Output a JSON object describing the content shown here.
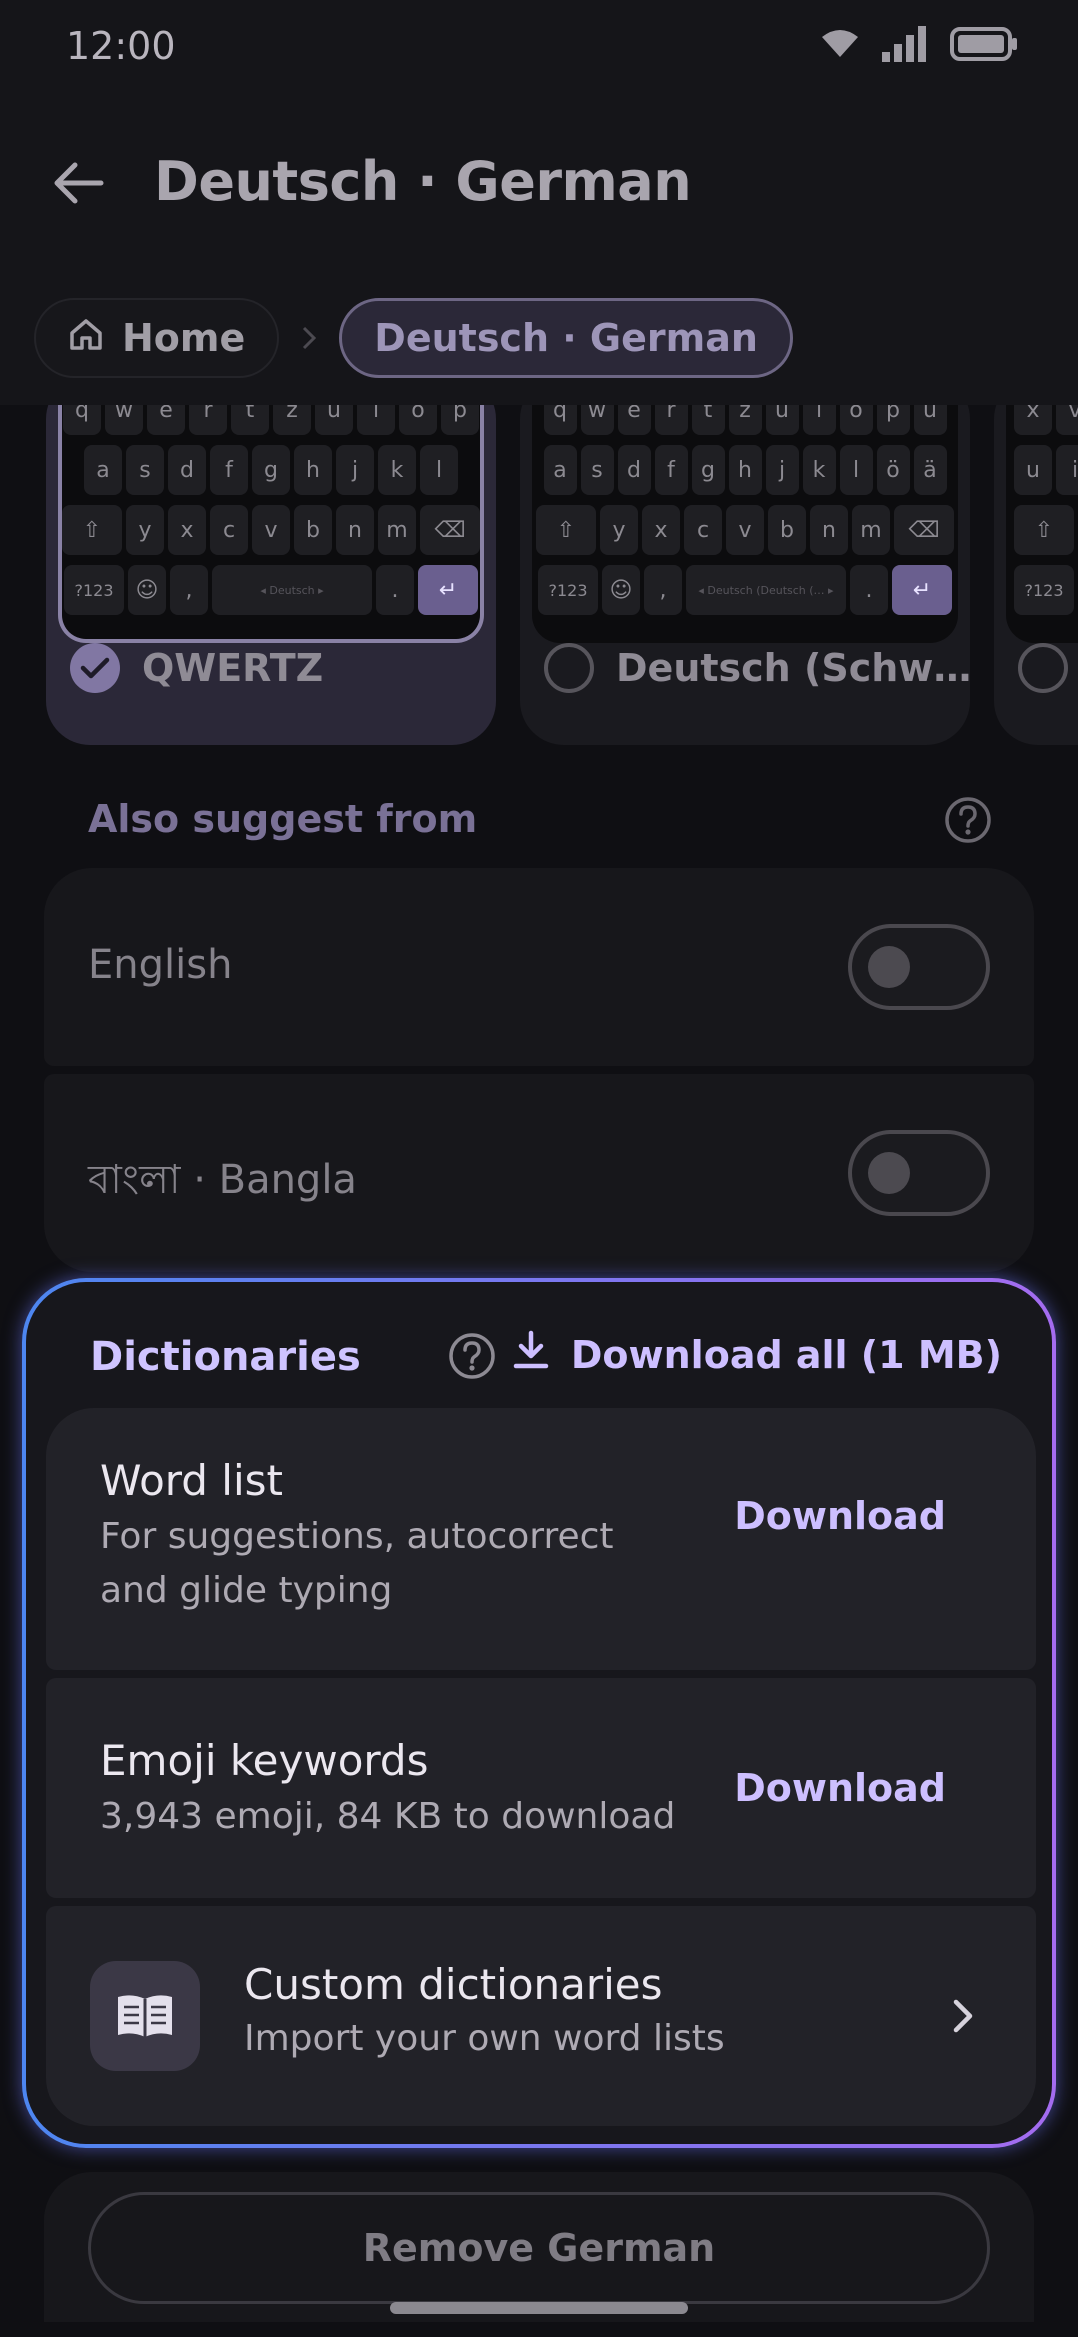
{
  "status_bar": {
    "time": "12:00",
    "icons": [
      "wifi-icon",
      "signal-icon",
      "battery-icon"
    ]
  },
  "header": {
    "title": "Deutsch · German",
    "back_icon": "arrow-left-icon"
  },
  "breadcrumb": {
    "home": "Home",
    "current": "Deutsch · German"
  },
  "layouts": [
    {
      "name": "QWERTZ",
      "selected": true,
      "rows": [
        [
          "q",
          "w",
          "e",
          "r",
          "t",
          "z",
          "u",
          "i",
          "o",
          "p"
        ],
        [
          "a",
          "s",
          "d",
          "f",
          "g",
          "h",
          "j",
          "k",
          "l"
        ],
        [
          "⇧",
          "y",
          "x",
          "c",
          "v",
          "b",
          "n",
          "m",
          "⌫"
        ]
      ],
      "bottom": [
        "?123",
        "☺",
        ",",
        "◂ Deutsch ▸",
        ".",
        "↵"
      ]
    },
    {
      "name": "Deutsch (Schw…",
      "selected": false,
      "rows": [
        [
          "q",
          "w",
          "e",
          "r",
          "t",
          "z",
          "u",
          "i",
          "o",
          "p",
          "ü"
        ],
        [
          "a",
          "s",
          "d",
          "f",
          "g",
          "h",
          "j",
          "k",
          "l",
          "ö",
          "ä"
        ],
        [
          "⇧",
          "y",
          "x",
          "c",
          "v",
          "b",
          "n",
          "m",
          "⌫"
        ]
      ],
      "bottom": [
        "?123",
        "☺",
        ",",
        "◂ Deutsch (Deutsch (… ▸",
        ".",
        "↵"
      ]
    },
    {
      "name": "",
      "selected": false,
      "rows": [
        [
          "x",
          "v"
        ],
        [
          "u",
          "i"
        ],
        [
          "⇧"
        ]
      ],
      "bottom": [
        "?123"
      ]
    }
  ],
  "also_suggest": {
    "title": "Also suggest from",
    "items": [
      {
        "label": "English",
        "enabled": false
      },
      {
        "label": "বাংলা · Bangla",
        "enabled": false
      }
    ]
  },
  "dictionaries": {
    "title": "Dictionaries",
    "download_all": "Download all (1 MB)",
    "items": [
      {
        "title": "Word list",
        "subtitle_line1": "For suggestions, autocorrect",
        "subtitle_line2": "and glide typing",
        "action": "Download"
      },
      {
        "title": "Emoji keywords",
        "subtitle_line1": "3,943 emoji, 84 KB to download",
        "action": "Download"
      },
      {
        "title": "Custom dictionaries",
        "subtitle_line1": "Import your own word lists",
        "icon": "book-icon"
      }
    ]
  },
  "remove_button": "Remove German",
  "colors": {
    "accent": "#cdbfff",
    "highlight_start": "#4d86f0",
    "highlight_end": "#a46cf0",
    "background": "#0f0f13"
  }
}
